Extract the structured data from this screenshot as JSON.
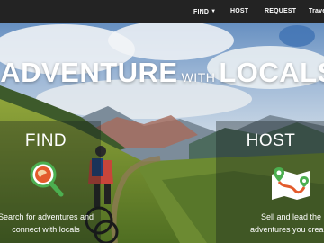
{
  "nav": {
    "items": [
      {
        "label": "FIND",
        "dropdown": true
      },
      {
        "label": "HOST"
      },
      {
        "label": "REQUEST"
      },
      {
        "label": "Travel"
      }
    ]
  },
  "hero": {
    "headline_left": "ADVENTURE",
    "headline_mid": "WITH",
    "headline_right": "LOCALS"
  },
  "panels": {
    "find": {
      "title": "FIND",
      "desc_line1": "Search for adventures and",
      "desc_line2": "connect with locals",
      "icon": "globe-magnifier-icon"
    },
    "host": {
      "title": "HOST",
      "desc_line1": "Sell and lead the",
      "desc_line2": "adventures you crea",
      "icon": "map-route-icon"
    }
  },
  "colors": {
    "navbar": "#232323",
    "accent_green": "#4caf50",
    "accent_orange": "#e35b2c"
  }
}
